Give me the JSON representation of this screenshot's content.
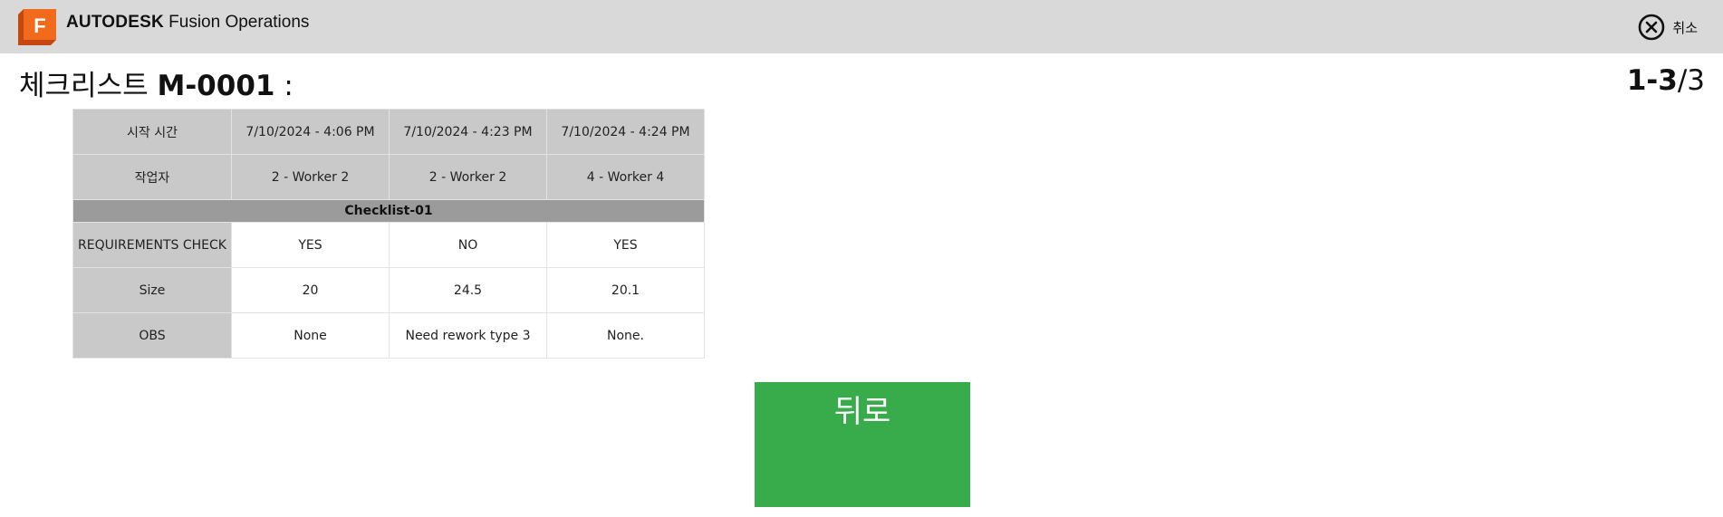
{
  "header": {
    "brand_bold": "AUTODESK",
    "brand_product": "Fusion Operations",
    "logo_letter": "F",
    "cancel_label": "취소"
  },
  "title": {
    "prefix": "체크리스트",
    "code": "M-0001",
    "suffix": ":"
  },
  "pager": {
    "range": "1-3",
    "total": "/3"
  },
  "table": {
    "start_time_label": "시작 시간",
    "start_times": [
      "7/10/2024 - 4:06 PM",
      "7/10/2024 - 4:23 PM",
      "7/10/2024 - 4:24 PM"
    ],
    "worker_label": "작업자",
    "workers": [
      "2 - Worker 2",
      "2 - Worker 2",
      "4 - Worker 4"
    ],
    "section_title": "Checklist-01",
    "rows": [
      {
        "label": "REQUIREMENTS CHECK",
        "values": [
          "YES",
          "NO",
          "YES"
        ]
      },
      {
        "label": "Size",
        "values": [
          "20",
          "24.5",
          "20.1"
        ]
      },
      {
        "label": "OBS",
        "values": [
          "None",
          "Need rework type 3",
          "None."
        ]
      }
    ]
  },
  "back_button": {
    "label": "뒤로"
  },
  "colors": {
    "topbar": "#d9d9d9",
    "logo_orange": "#f26b1d",
    "label_gray": "#c9c9c9",
    "section_gray": "#9b9b9b",
    "button_green": "#38ab4a"
  }
}
